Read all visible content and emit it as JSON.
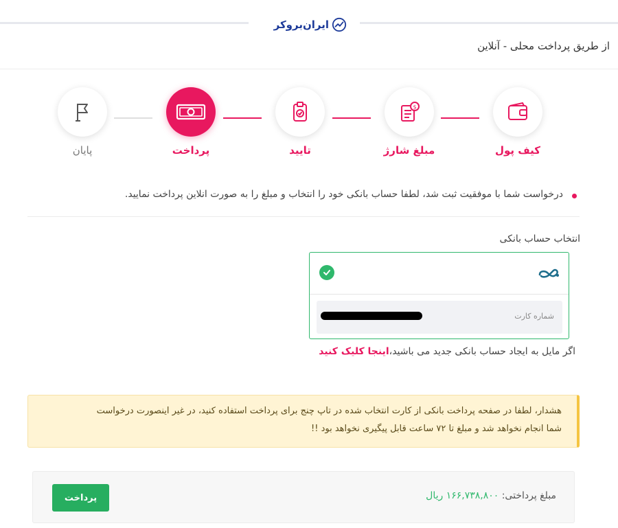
{
  "brand": {
    "logo_text": "ایران‌بروکر",
    "logo_icon": "growth-chart-icon"
  },
  "header": {
    "title": "از طریق پرداخت محلی - آنلاین"
  },
  "stepper": {
    "steps": [
      {
        "label": "کیف پول",
        "icon": "wallet-icon",
        "state": "done"
      },
      {
        "label": "مبلغ شارژ",
        "icon": "invoice-dollar-icon",
        "state": "done"
      },
      {
        "label": "تایید",
        "icon": "clipboard-check-icon",
        "state": "done"
      },
      {
        "label": "پرداخت",
        "icon": "banknote-icon",
        "state": "active"
      },
      {
        "label": "پایان",
        "icon": "flag-icon",
        "state": "pending"
      }
    ],
    "accent_color": "#e8185f"
  },
  "info": {
    "message": "درخواست شما با موفقیت ثبت شد، لطفا حساب بانکی خود را انتخاب و مبلغ را به صورت انلاین پرداخت نمایید."
  },
  "bank_selection": {
    "label": "انتخاب حساب بانکی",
    "selected_icon": "check-circle-icon",
    "bank_icon": "infinity-bank-logo-icon",
    "card_number_label": "شماره کارت",
    "card_number_value": "",
    "selected_color": "#2fb86c"
  },
  "new_account": {
    "text": "اگر مایل به ایجاد حساب بانکی جدید می باشید،",
    "link": "اینجا کلیک کنید"
  },
  "warning": {
    "line1": "هشدار، لطفا در صفحه پرداخت بانکی از کارت انتخاب شده در تاپ چنج برای پرداخت استفاده کنید، در غیر اینصورت درخواست",
    "line2": "شما انجام نخواهد شد و مبلغ تا ۷۲ ساعت قابل پیگیری نخواهد بود !!"
  },
  "payment": {
    "amount_label": "مبلغ پرداختی:",
    "amount_value": "۱۶۶,۷۳۸,۸۰۰ ریال",
    "button_label": "پرداخت",
    "button_color": "#27ae60"
  }
}
